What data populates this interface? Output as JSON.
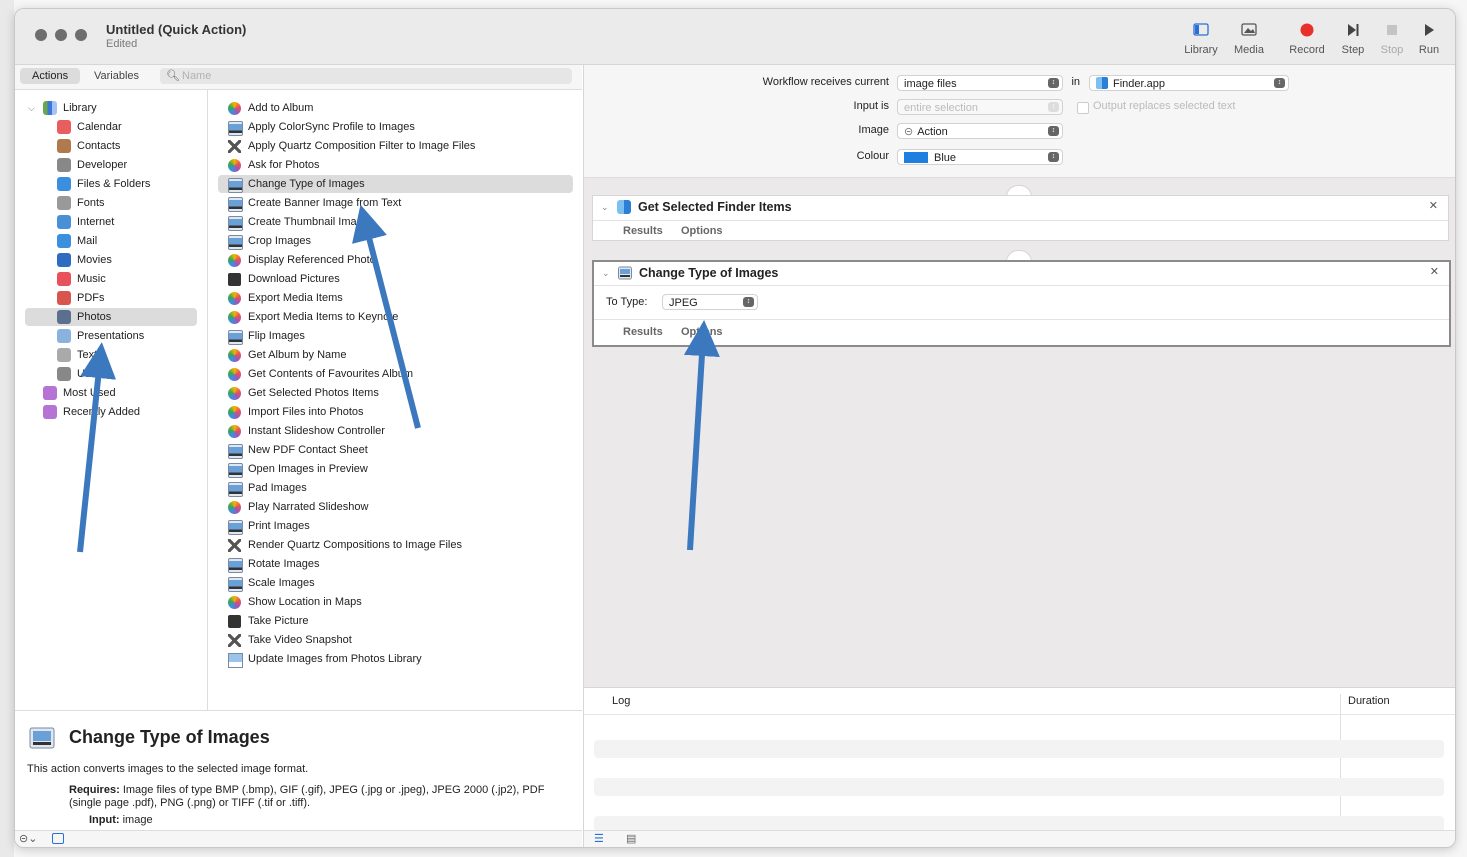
{
  "window": {
    "title": "Untitled (Quick Action)",
    "subtitle": "Edited"
  },
  "toolbar": {
    "library": "Library",
    "media": "Media",
    "record": "Record",
    "step": "Step",
    "stop": "Stop",
    "run": "Run"
  },
  "tabs": {
    "actions": "Actions",
    "variables": "Variables"
  },
  "search": {
    "placeholder": "Name"
  },
  "library": {
    "root": "Library",
    "items": [
      "Calendar",
      "Contacts",
      "Developer",
      "Files & Folders",
      "Fonts",
      "Internet",
      "Mail",
      "Movies",
      "Music",
      "PDFs",
      "Photos",
      "Presentations",
      "Text",
      "Utilities"
    ],
    "smart": [
      "Most Used",
      "Recently Added"
    ],
    "selected": "Photos"
  },
  "actions": [
    "Add to Album",
    "Apply ColorSync Profile to Images",
    "Apply Quartz Composition Filter to Image Files",
    "Ask for Photos",
    "Change Type of Images",
    "Create Banner Image from Text",
    "Create Thumbnail Images",
    "Crop Images",
    "Display Referenced Photo",
    "Download Pictures",
    "Export Media Items",
    "Export Media Items to Keynote",
    "Flip Images",
    "Get Album by Name",
    "Get Contents of Favourites Album",
    "Get Selected Photos Items",
    "Import Files into Photos",
    "Instant Slideshow Controller",
    "New PDF Contact Sheet",
    "Open Images in Preview",
    "Pad Images",
    "Play Narrated Slideshow",
    "Print Images",
    "Render Quartz Compositions to Image Files",
    "Rotate Images",
    "Scale Images",
    "Show Location in Maps",
    "Take Picture",
    "Take Video Snapshot",
    "Update Images from Photos Library"
  ],
  "description": {
    "title": "Change Type of Images",
    "text": "This action converts images to the selected image format.",
    "requires_label": "Requires:",
    "requires": "Image files of type BMP (.bmp), GIF (.gif), JPEG (.jpg or .jpeg), JPEG 2000 (.jp2), PDF (single page .pdf), PNG (.png) or TIFF (.tif or .tiff).",
    "input_label": "Input:",
    "input": "image"
  },
  "workflow": {
    "receives_label": "Workflow receives current",
    "receives_value": "image files",
    "in_label": "in",
    "in_value": "Finder.app",
    "input_is_label": "Input is",
    "input_is_value": "entire selection",
    "output_replaces": "Output replaces selected text",
    "image_label": "Image",
    "image_value": "Action",
    "colour_label": "Colour",
    "colour_value": "Blue",
    "colour_hex": "#1f7fe0"
  },
  "cards": [
    {
      "title": "Get Selected Finder Items",
      "results": "Results",
      "options": "Options"
    },
    {
      "title": "Change Type of Images",
      "to_type_label": "To Type:",
      "to_type_value": "JPEG",
      "results": "Results",
      "options": "Options"
    }
  ],
  "log": {
    "col_log": "Log",
    "col_duration": "Duration"
  },
  "icons": [
    "library-icon",
    "media-icon",
    "record-icon",
    "step-icon",
    "stop-icon",
    "run-icon",
    "search-icon",
    "close-icon",
    "chevron-down-icon"
  ],
  "colors": {
    "record": "#e8302a",
    "annotation_arrow": "#3b78be",
    "selection": "#dcdcdc"
  }
}
